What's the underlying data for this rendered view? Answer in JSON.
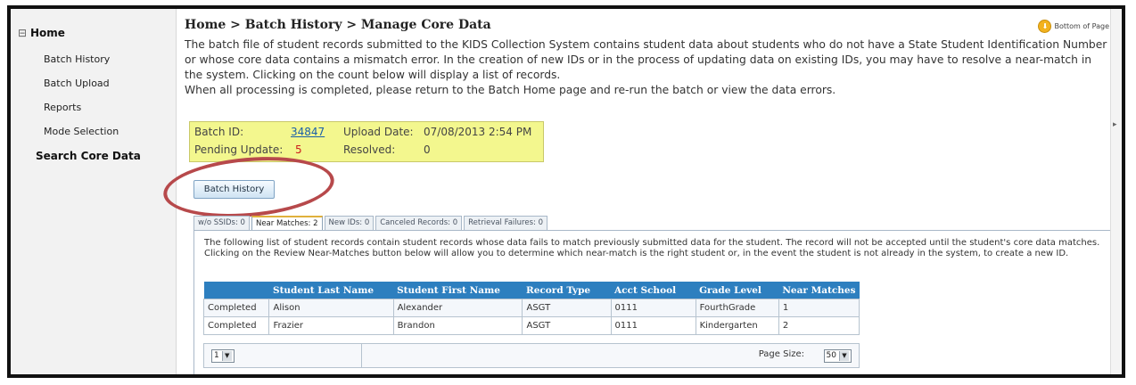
{
  "sidebar": {
    "home": "Home",
    "items": [
      {
        "label": "Batch History"
      },
      {
        "label": "Batch Upload"
      },
      {
        "label": "Reports"
      },
      {
        "label": "Mode Selection"
      }
    ],
    "search_core_data": "Search Core Data"
  },
  "header": {
    "breadcrumb": "Home > Batch History > Manage Core Data",
    "bottom_of_page": "Bottom of Page"
  },
  "intro": {
    "paragraph": "The batch file of student records submitted to the KIDS Collection System contains student data about students who do not have a State Student Identification Number or whose core data contains a mismatch error. In the creation of new IDs or in the process of updating data on existing IDs, you may have to resolve a near-match in the system. Clicking on the count below will display a list of records.",
    "line2": "When all processing is completed, please return to the Batch Home page and re-run the batch or view the data errors."
  },
  "batch": {
    "batch_id_label": "Batch ID:",
    "batch_id": "34847",
    "upload_date_label": "Upload Date:",
    "upload_date": "07/08/2013 2:54 PM",
    "pending_label": "Pending Update:",
    "pending": "5",
    "resolved_label": "Resolved:",
    "resolved": "0"
  },
  "buttons": {
    "batch_history": "Batch History"
  },
  "tabs": [
    {
      "label": "w/o SSIDs: 0"
    },
    {
      "label": "Near Matches: 2"
    },
    {
      "label": "New IDs: 0"
    },
    {
      "label": "Canceled Records: 0"
    },
    {
      "label": "Retrieval Failures: 0"
    }
  ],
  "panel": {
    "description": "The following list of student records contain student records whose data fails to match previously submitted data for the student. The record will not be accepted until the student's core data matches. Clicking on the Review Near-Matches button below will allow you to determine which near-match is the right student or, in the event the student is not already in the system, to create a new ID."
  },
  "table": {
    "columns": [
      "",
      "Student Last Name",
      "Student First Name",
      "Record Type",
      "Acct School",
      "Grade Level",
      "Near Matches"
    ],
    "rows": [
      [
        "Completed",
        "Alison",
        "Alexander",
        "ASGT",
        "0111",
        "FourthGrade",
        "1"
      ],
      [
        "Completed",
        "Frazier",
        "Brandon",
        "ASGT",
        "0111",
        "Kindergarten",
        "2"
      ]
    ]
  },
  "pager": {
    "page": "1",
    "page_size_label": "Page Size:",
    "page_size": "50"
  },
  "colors": {
    "header_blue": "#2d7fbf",
    "batch_box_yellow": "#f3f78e",
    "highlight_red": "#b7494b",
    "link_blue": "#1a5fa8",
    "pending_red": "#cc1b1b"
  }
}
